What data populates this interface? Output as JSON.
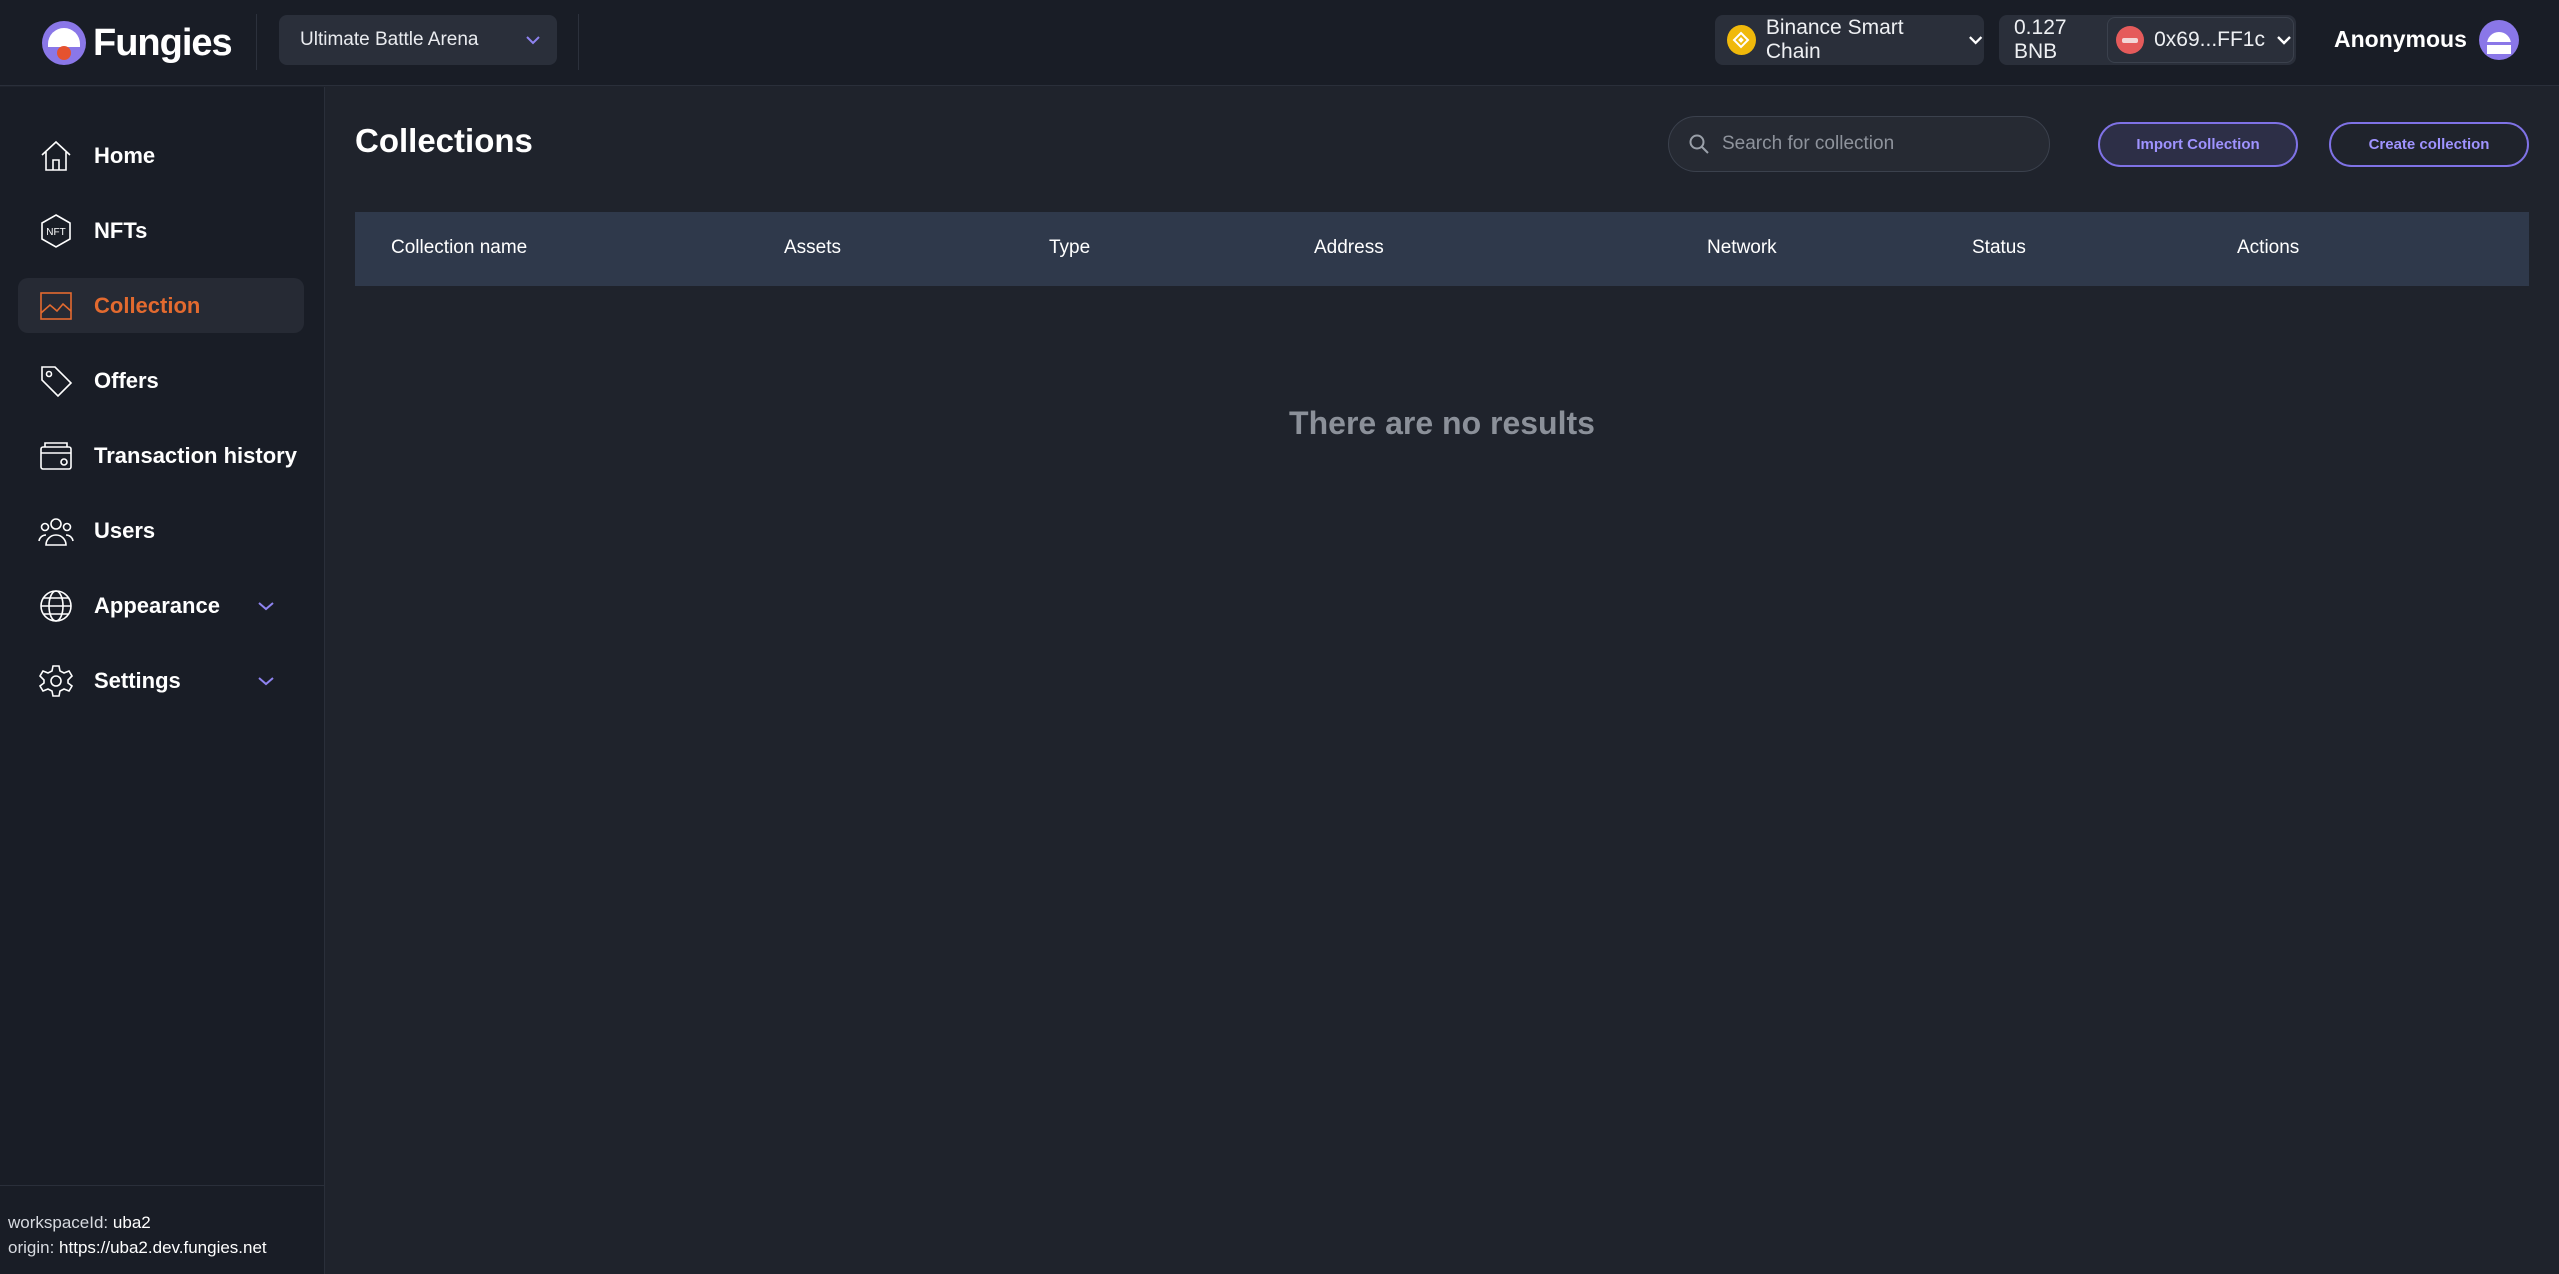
{
  "brand": {
    "name": "Fungies"
  },
  "header": {
    "workspace": "Ultimate Battle Arena",
    "chain": "Binance Smart Chain",
    "balance": "0.127 BNB",
    "wallet_address": "0x69...FF1c",
    "user_name": "Anonymous"
  },
  "sidebar": {
    "items": [
      {
        "label": "Home",
        "icon": "home-icon"
      },
      {
        "label": "NFTs",
        "icon": "nft-icon"
      },
      {
        "label": "Collection",
        "icon": "image-icon",
        "active": true
      },
      {
        "label": "Offers",
        "icon": "tag-icon"
      },
      {
        "label": "Transaction history",
        "icon": "wallet-icon"
      },
      {
        "label": "Users",
        "icon": "users-icon"
      },
      {
        "label": "Appearance",
        "icon": "globe-icon",
        "expandable": true
      },
      {
        "label": "Settings",
        "icon": "gear-icon",
        "expandable": true
      }
    ],
    "footer": {
      "workspace_label": "workspaceId:",
      "workspace_value": "uba2",
      "origin_label": "origin:",
      "origin_value": "https://uba2.dev.fungies.net"
    }
  },
  "main": {
    "title": "Collections",
    "search_placeholder": "Search for collection",
    "import_button": "Import Collection",
    "create_button": "Create collection",
    "columns": [
      "Collection name",
      "Assets",
      "Type",
      "Address",
      "Network",
      "Status",
      "Actions"
    ],
    "empty_message": "There are no results"
  },
  "colors": {
    "accent": "#7f72e6",
    "active_nav": "#e36a2f",
    "background": "#1f232c",
    "panel": "#191d26"
  }
}
